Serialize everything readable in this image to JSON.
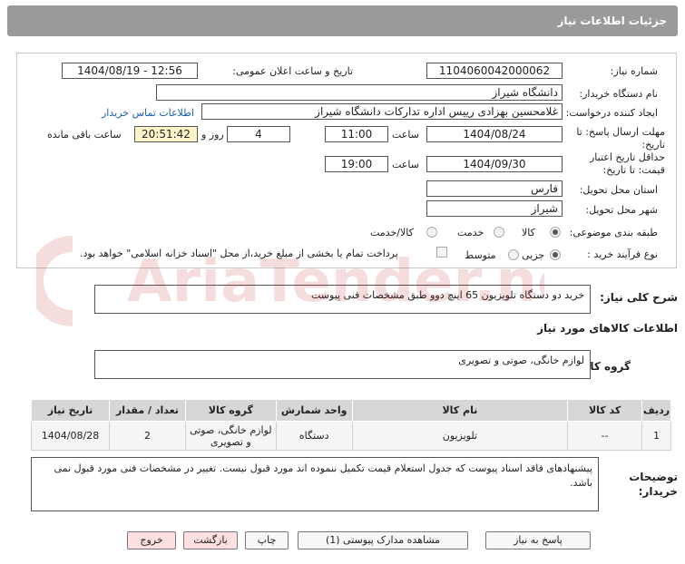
{
  "header": {
    "title": "جزئیات اطلاعات نیاز"
  },
  "form": {
    "need_number_label": "شماره نیاز:",
    "need_number": "1104060042000062",
    "announce_label": "تاریخ و ساعت اعلان عمومی:",
    "announce_value": "1404/08/19 - 12:56",
    "buyer_org_label": "نام دستگاه خریدار:",
    "buyer_org": "دانشگاه شیراز",
    "creator_label": "ایجاد کننده درخواست:",
    "creator": "غلامحسین بهزادی رییس اداره تدارکات دانشگاه شیراز",
    "contact_link": "اطلاعات تماس خریدار",
    "deadline_label": "مهلت ارسال پاسخ: تا تاریخ:",
    "deadline_date": "1404/08/24",
    "time_label": "ساعت",
    "deadline_time": "11:00",
    "days_count": "4",
    "days_label": "روز و",
    "remaining_time": "20:51:42",
    "remaining_label": "ساعت باقی مانده",
    "validity_label": "حداقل تاریخ اعتبار قیمت: تا تاریخ:",
    "validity_date": "1404/09/30",
    "validity_time": "19:00",
    "province_label": "استان محل تحویل:",
    "province": "فارس",
    "city_label": "شهر محل تحویل:",
    "city": "شیراز",
    "category_label": "طبقه بندی موضوعی:",
    "category_options": [
      "کالا",
      "خدمت",
      "کالا/خدمت"
    ],
    "category_selected": "کالا",
    "process_label": "نوع فرآیند خرید :",
    "process_options": [
      "جزیی",
      "متوسط"
    ],
    "process_selected": "جزیی",
    "payment_note": "پرداخت تمام یا بخشی از مبلغ خرید،از محل \"اسناد خزانه اسلامی\" خواهد بود."
  },
  "summary": {
    "label": "شرح کلی نیاز:",
    "text": "خرید دو دستگاه تلویزیون 65 اینچ دوو طبق مشخصات فنی پیوست"
  },
  "goods": {
    "section_title": "اطلاعات کالاهای مورد نیاز",
    "group_label": "گروه کالا:",
    "group_value": "لوازم خانگی، صوتی و تصویری"
  },
  "table": {
    "headers": [
      "ردیف",
      "کد کالا",
      "نام کالا",
      "واحد شمارش",
      "گروه کالا",
      "تعداد / مقدار",
      "تاریخ نیاز"
    ],
    "rows": [
      {
        "row": "1",
        "code": "--",
        "name": "تلویزیون",
        "unit": "دستگاه",
        "group": "لوازم خانگی، صوتی و تصویری",
        "qty": "2",
        "date": "1404/08/28"
      }
    ]
  },
  "notes": {
    "label": "توضیحات خریدار:",
    "text": "پیشنهادهای فاقد اسناد پیوست که جدول استعلام قیمت تکمیل ننموده اند مورد قبول نیست. تغییر در مشخصات فنی مورد قبول نمی باشد."
  },
  "footer": {
    "reply": "پاسخ به نیاز",
    "attachments": "مشاهده مدارک پیوستی (1)",
    "print": "چاپ",
    "back": "بازگشت",
    "exit": "خروج"
  },
  "watermark_text": "AriaTender.neT",
  "colors": {
    "header": "#9a9a9a",
    "link": "#1a5fb4",
    "highlight": "#fdf5c9",
    "table_header": "#d7d7d7",
    "exit_button": "#ffe0e0"
  }
}
